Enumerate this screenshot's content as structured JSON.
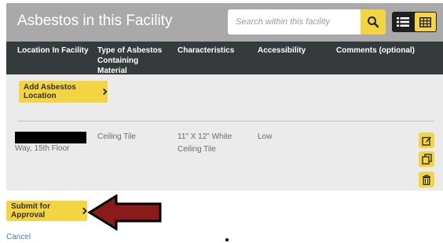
{
  "header": {
    "title": "Asbestos in this Facility",
    "search_placeholder": "Search within this facility",
    "search_icon": "search-icon",
    "list_view_icon": "list-icon",
    "grid_view_icon": "grid-icon"
  },
  "table": {
    "columns": [
      "Location In Facility",
      "Type of Asbestos Containing Material",
      "Characteristics",
      "Accessibility",
      "Comments (optional)"
    ],
    "add_button_label": "Add Asbestos Location",
    "rows": [
      {
        "location": "Way, 15th Floor",
        "type": "Ceiling Tile",
        "characteristics": "11\" X 12\" White Ceiling Tile",
        "accessibility": "Low",
        "comments": "",
        "actions": [
          "edit-icon",
          "copy-icon",
          "trash-icon"
        ]
      }
    ]
  },
  "footer": {
    "submit_label": "Submit for Approval",
    "cancel_label": "Cancel"
  },
  "colors": {
    "accent_yellow": "#f3d443",
    "header_gray": "#a9a9a9",
    "table_header_dark": "#353a3c",
    "panel_gray": "#ebebeb",
    "annotation_arrow": "#8b1a1a",
    "link_blue": "#4a7bb0"
  }
}
